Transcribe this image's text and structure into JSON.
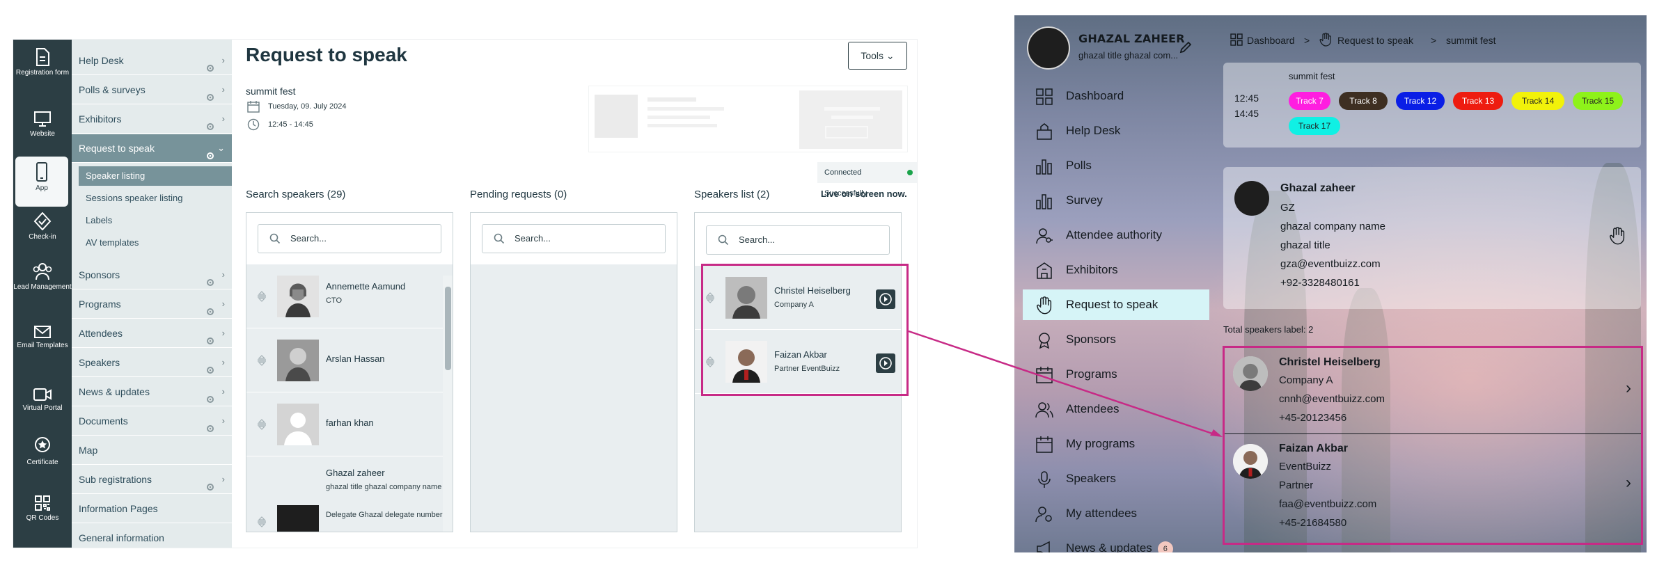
{
  "admin": {
    "rail": [
      {
        "label": "Registration form",
        "icon": "document-icon"
      },
      {
        "label": "Website",
        "icon": "monitor-icon"
      },
      {
        "label": "App",
        "icon": "mobile-icon",
        "active": true
      },
      {
        "label": "Check-in",
        "icon": "check-in-icon"
      },
      {
        "label": "Lead Management",
        "icon": "people-icon"
      },
      {
        "label": "Email Templates",
        "icon": "mail-icon"
      },
      {
        "label": "Virtual Portal",
        "icon": "video-icon"
      },
      {
        "label": "Certificate",
        "icon": "certificate-icon"
      },
      {
        "label": "QR Codes",
        "icon": "qr-code-icon"
      }
    ],
    "menu": [
      {
        "label": "Help Desk"
      },
      {
        "label": "Polls & surveys"
      },
      {
        "label": "Exhibitors"
      },
      {
        "label": "Request to speak",
        "active": true
      },
      {
        "label": "Sponsors"
      },
      {
        "label": "Programs"
      },
      {
        "label": "Attendees"
      },
      {
        "label": "Speakers"
      },
      {
        "label": "News & updates"
      },
      {
        "label": "Documents"
      },
      {
        "label": "Map"
      },
      {
        "label": "Sub registrations"
      },
      {
        "label": "Information Pages"
      },
      {
        "label": "General information"
      }
    ],
    "submenu": [
      "Speaker listing",
      "Sessions speaker listing",
      "Labels",
      "AV templates"
    ],
    "page_title": "Request to speak",
    "tools_label": "Tools",
    "event": {
      "name": "summit fest",
      "date": "Tuesday, 09. July 2024",
      "time": "12:45 - 14:45"
    },
    "connection_status": "Connected Successfully",
    "columns": {
      "search_title": "Search speakers (29)",
      "pending_title": "Pending requests (0)",
      "speakers_title": "Speakers list (2)",
      "live_label": "Live on screen now.",
      "search_placeholder": "Search..."
    },
    "search_speakers": [
      {
        "name": "Annemette Aamund",
        "sub": "CTO"
      },
      {
        "name": "Arslan Hassan",
        "sub": ""
      },
      {
        "name": "farhan khan",
        "sub": ""
      },
      {
        "name": "Ghazal zaheer",
        "sub": "ghazal title ghazal company name",
        "sub2": "Delegate Ghazal delegate number"
      }
    ],
    "speakers_list": [
      {
        "name": "Christel Heiselberg",
        "sub": "Company A"
      },
      {
        "name": "Faizan Akbar",
        "sub": "Partner EventBuizz"
      }
    ],
    "colors": {
      "rail": "#2c3e44",
      "menu": "#e4ebec",
      "active": "#77939a",
      "status": "#1aa34a"
    }
  },
  "mobile": {
    "user": {
      "name": "GHAZAL ZAHEER",
      "title": "ghazal title ghazal com..."
    },
    "breadcrumb": [
      "Dashboard",
      ">",
      "Request to speak",
      ">",
      "summit fest"
    ],
    "nav": [
      {
        "label": "Dashboard",
        "icon": "grid-icon"
      },
      {
        "label": "Help Desk",
        "icon": "help-desk-icon"
      },
      {
        "label": "Polls",
        "icon": "bar-chart-icon"
      },
      {
        "label": "Survey",
        "icon": "bar-chart-icon"
      },
      {
        "label": "Attendee authority",
        "icon": "user-key-icon"
      },
      {
        "label": "Exhibitors",
        "icon": "building-icon"
      },
      {
        "label": "Request to speak",
        "icon": "hand-icon",
        "active": true
      },
      {
        "label": "Sponsors",
        "icon": "award-icon"
      },
      {
        "label": "Programs",
        "icon": "calendar-icon"
      },
      {
        "label": "Attendees",
        "icon": "people-icon"
      },
      {
        "label": "My programs",
        "icon": "calendar-icon"
      },
      {
        "label": "Speakers",
        "icon": "microphone-icon"
      },
      {
        "label": "My attendees",
        "icon": "user-gear-icon"
      },
      {
        "label": "News & updates",
        "icon": "megaphone-icon",
        "badge": "6"
      }
    ],
    "session": {
      "title": "summit fest",
      "start": "12:45",
      "end": "14:45",
      "tracks": [
        {
          "label": "Track 7",
          "bg": "#ff1ee0",
          "fg": "#ffffff"
        },
        {
          "label": "Track 8",
          "bg": "#3e2f22",
          "fg": "#ffffff"
        },
        {
          "label": "Track 12",
          "bg": "#0a1ee6",
          "fg": "#ffffff"
        },
        {
          "label": "Track 13",
          "bg": "#ee1c10",
          "fg": "#ffffff"
        },
        {
          "label": "Track 14",
          "bg": "#f2f20a",
          "fg": "#222222"
        },
        {
          "label": "Track 15",
          "bg": "#8ef21a",
          "fg": "#222222"
        },
        {
          "label": "Track 17",
          "bg": "#10f0e4",
          "fg": "#222222"
        }
      ]
    },
    "profile": {
      "name": "Ghazal zaheer",
      "initials": "GZ",
      "company": "ghazal company name",
      "title": "ghazal title",
      "email": "gza@eventbuizz.com",
      "phone": "+92-3328480161"
    },
    "total_label": "Total speakers label: 2",
    "speakers": [
      {
        "name": "Christel Heiselberg",
        "company": "Company A",
        "email": "cnnh@eventbuizz.com",
        "phone": "+45-20123456"
      },
      {
        "name": "Faizan Akbar",
        "company": "EventBuizz",
        "title": "Partner",
        "email": "faa@eventbuizz.com",
        "phone": "+45-21684580"
      }
    ]
  },
  "annotation_color": "#c72a86"
}
